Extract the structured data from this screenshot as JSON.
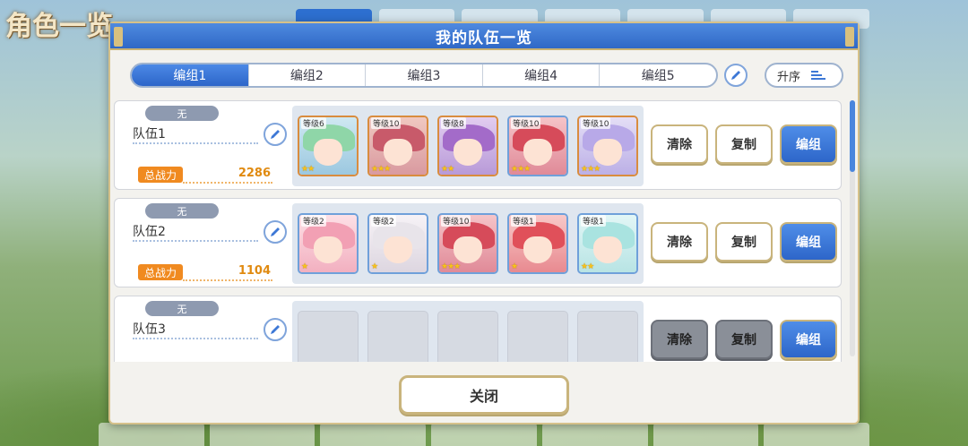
{
  "background": {
    "title": "角色一览"
  },
  "dialog": {
    "title": "我的队伍一览"
  },
  "tabs": [
    "编组1",
    "编组2",
    "编组3",
    "编组4",
    "编组5"
  ],
  "active_tab": 0,
  "sort_label": "升序",
  "close_label": "关闭",
  "power_label": "总战力",
  "buttons": {
    "clear": "清除",
    "copy": "复制",
    "edit": "编组"
  },
  "teams": [
    {
      "badge": "无",
      "name": "队伍1",
      "power": "2286",
      "characters": [
        {
          "level": "等级6",
          "stars": "★★",
          "hair": "#8fd6a8"
        },
        {
          "level": "等级10",
          "stars": "★★★",
          "hair": "#c85a6a"
        },
        {
          "level": "等级8",
          "stars": "★★",
          "hair": "#a36bc9"
        },
        {
          "level": "等级10",
          "stars": "★★★",
          "hair": "#d64b5a"
        },
        {
          "level": "等级10",
          "stars": "★★★",
          "hair": "#b8a9e8"
        }
      ]
    },
    {
      "badge": "无",
      "name": "队伍2",
      "power": "1104",
      "characters": [
        {
          "level": "等级2",
          "stars": "★",
          "hair": "#f2a0b4"
        },
        {
          "level": "等级2",
          "stars": "★",
          "hair": "#e8e4ea"
        },
        {
          "level": "等级10",
          "stars": "★★★",
          "hair": "#d64b5a"
        },
        {
          "level": "等级1",
          "stars": "★",
          "hair": "#e0505a"
        },
        {
          "level": "等级1",
          "stars": "★★",
          "hair": "#a9e3e0"
        }
      ]
    },
    {
      "badge": "无",
      "name": "队伍3",
      "power": "",
      "characters": []
    }
  ]
}
